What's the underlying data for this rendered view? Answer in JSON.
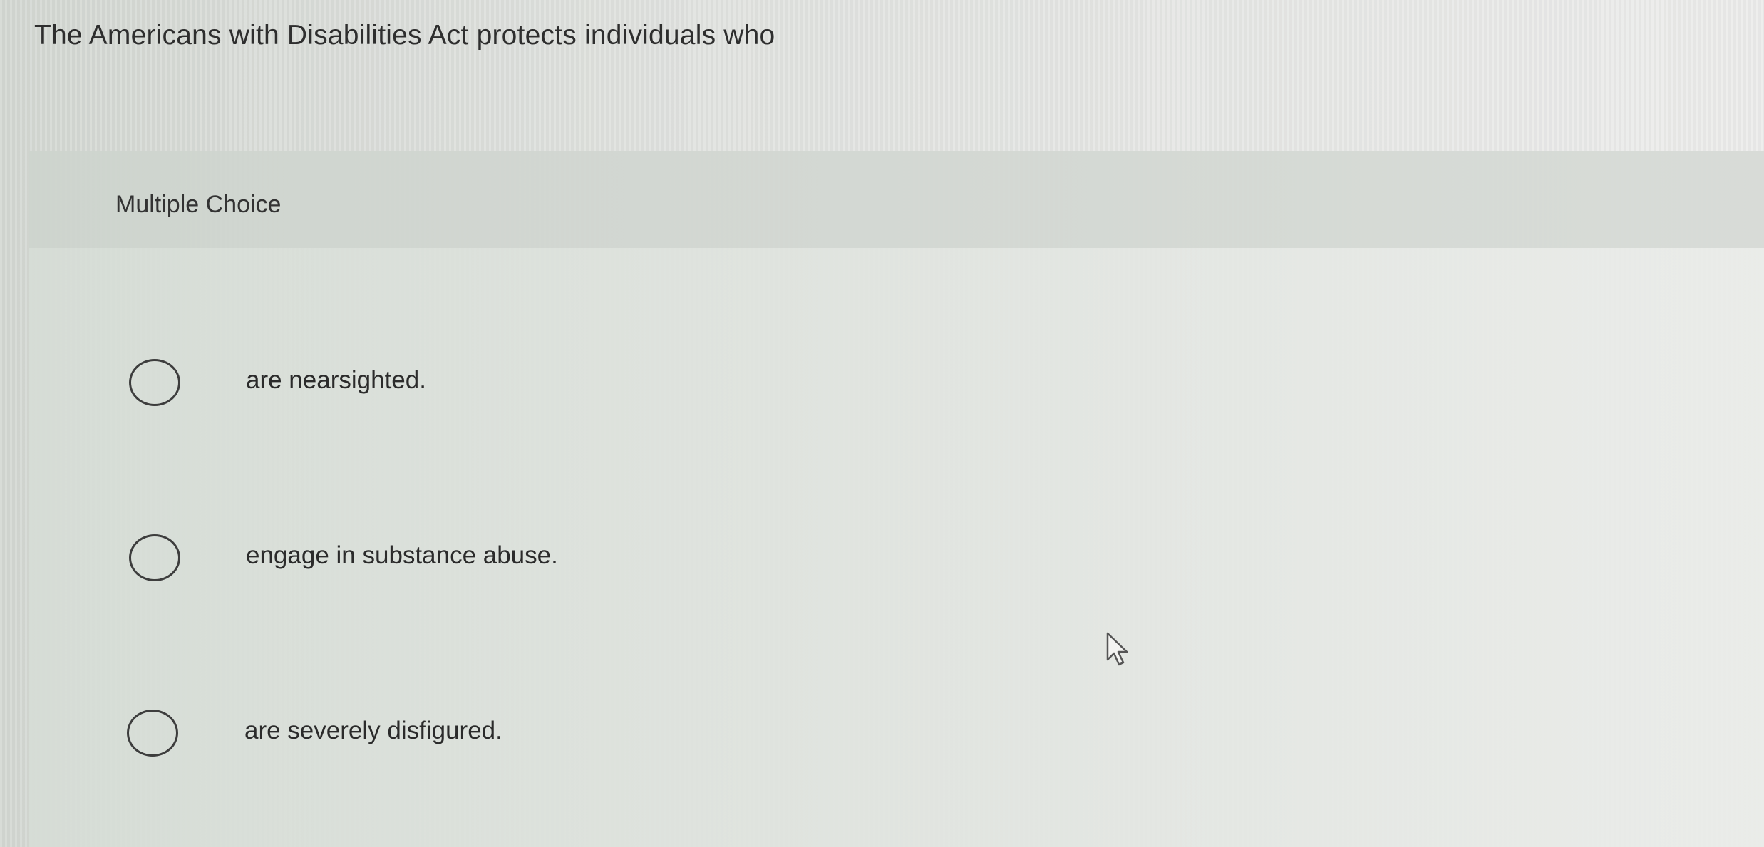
{
  "question": {
    "text": "The Americans with Disabilities Act protects individuals who"
  },
  "answer_panel": {
    "header_label": "Multiple Choice",
    "choices": [
      {
        "label": "are nearsighted.",
        "selected": false
      },
      {
        "label": "engage in substance abuse.",
        "selected": false
      },
      {
        "label": "are severely disfigured.",
        "selected": false
      }
    ]
  },
  "colors": {
    "text": "#2b2b2b",
    "radio_border": "#3d3d3d",
    "background": "#dfe1de"
  },
  "icons": {
    "cursor": "mouse-pointer-icon"
  }
}
